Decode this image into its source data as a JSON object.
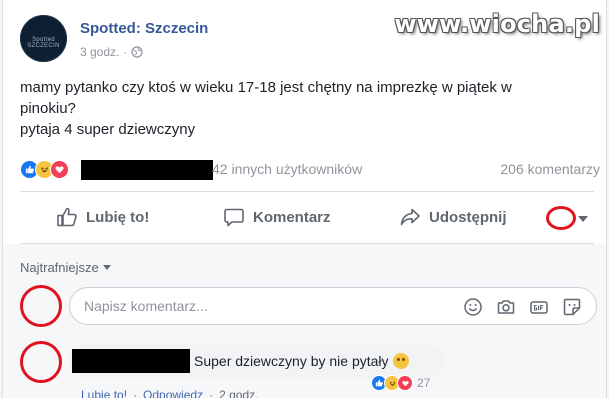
{
  "watermark": "www.wiocha.pl",
  "post": {
    "page_name": "Spotted: Szczecin",
    "time": "3 godz.",
    "separator": "·",
    "avatar_text": "Spotted SZCZECIN",
    "text_lines": [
      "mamy pytanko czy ktoś w wieku 17-18 jest chętny na imprezkę w piątek w",
      "pinokiu?",
      "pytaja 4 super dziewczyny"
    ],
    "reacted_others": "42 innych użytkowników",
    "comments_count": "206 komentarzy"
  },
  "actions": {
    "like": "Lubię to!",
    "comment": "Komentarz",
    "share": "Udostępnij"
  },
  "comments_section": {
    "sort_label": "Najtrafniejsze",
    "input_placeholder": "Napisz komentarz...",
    "box_icons": [
      "emoji-icon",
      "camera-icon",
      "gif-icon",
      "sticker-icon"
    ]
  },
  "comment": {
    "text": "Super dziewczyny by nie pytały",
    "reaction_count": "27",
    "like_label": "Lubię to!",
    "reply_label": "Odpowiedz",
    "time": "2 godz."
  },
  "colors": {
    "link_blue": "#365899",
    "annotation_red": "#e0141e",
    "like_blue": "#1877f2",
    "haha_yellow": "#f7c440",
    "love_red": "#f33e58"
  }
}
